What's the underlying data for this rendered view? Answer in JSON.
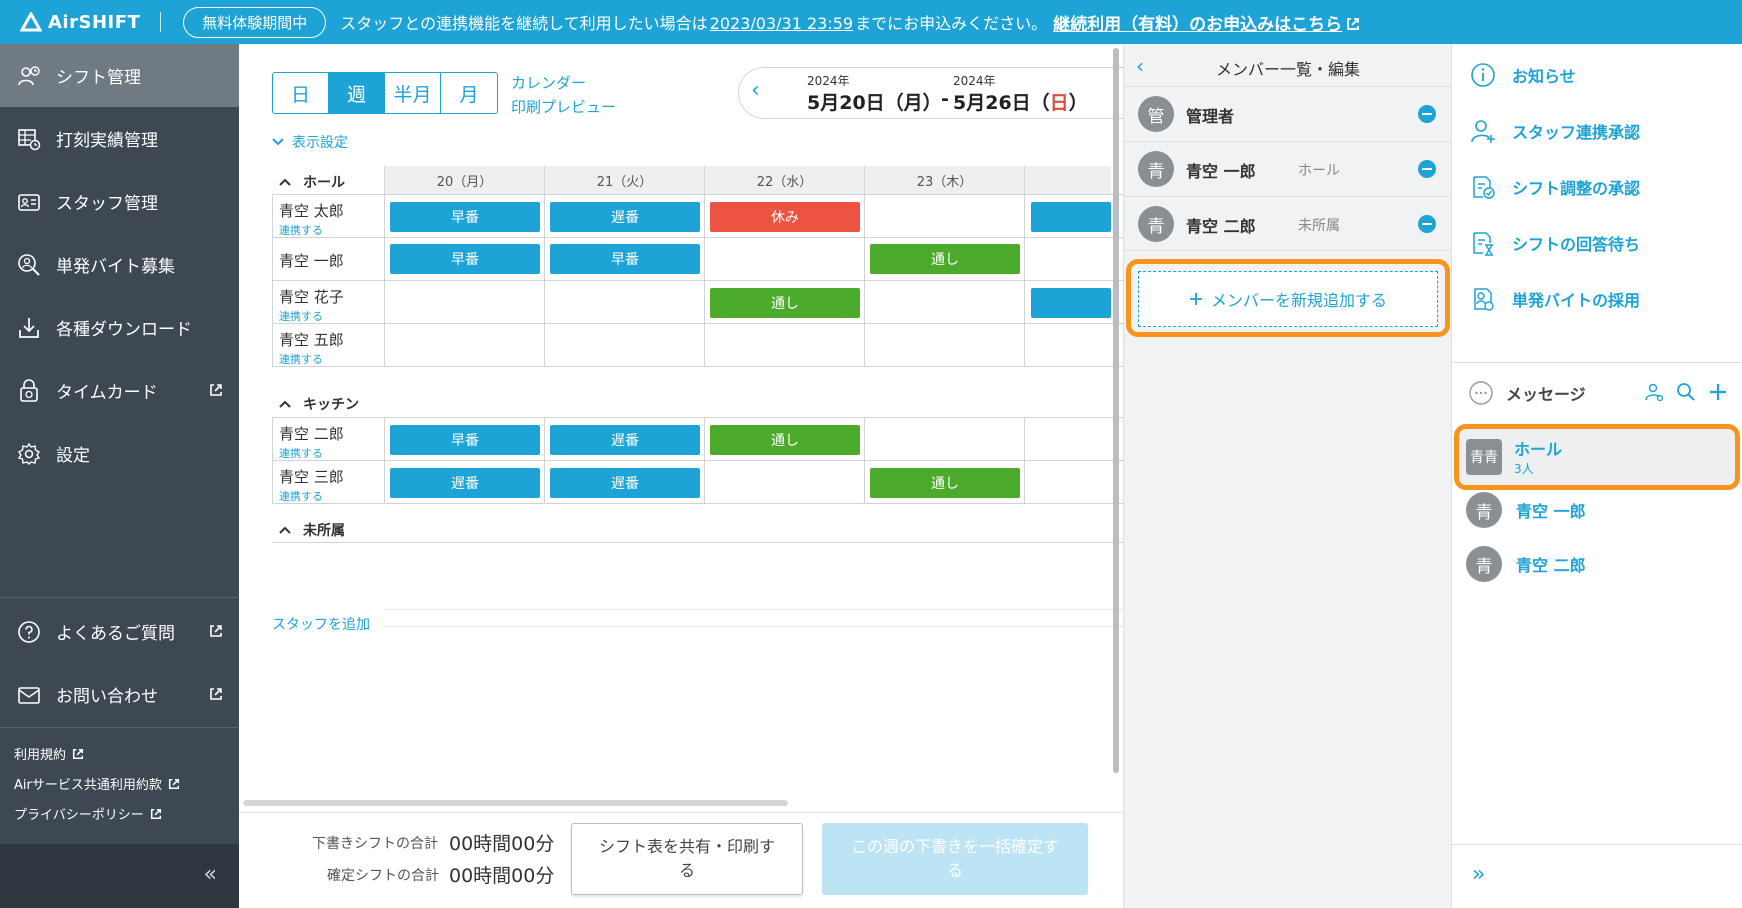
{
  "banner": {
    "logo": "AirSHIFT",
    "trial_badge": "無料体験期間中",
    "text_before": "スタッフとの連携機能を継続して利用したい場合は",
    "deadline": "2023/03/31 23:59",
    "text_after": "までにお申込みください。",
    "cta": "継続利用（有料）のお申込みはこちら"
  },
  "sidebar": {
    "items": [
      {
        "label": "シフト管理"
      },
      {
        "label": "打刻実績管理"
      },
      {
        "label": "スタッフ管理"
      },
      {
        "label": "単発バイト募集"
      },
      {
        "label": "各種ダウンロード"
      },
      {
        "label": "タイムカード"
      },
      {
        "label": "設定"
      }
    ],
    "faq": "よくあるご質問",
    "contact": "お問い合わせ",
    "terms": "利用規約",
    "air_terms": "Airサービス共通利用約款",
    "privacy": "プライバシーポリシー",
    "collapse": "«"
  },
  "toolbar": {
    "views": [
      "日",
      "週",
      "半月",
      "月"
    ],
    "selected_view": "週",
    "calendar": "カレンダー",
    "print_preview": "印刷プレビュー",
    "display_settings": "表示設定"
  },
  "date_range": {
    "start_year": "2024年",
    "start": "5月20日（月）",
    "separator": "-",
    "end_year": "2024年",
    "end_prefix": "5月26日（",
    "end_day": "日",
    "end_suffix": "）"
  },
  "grid": {
    "days": [
      "20（月）",
      "21（火）",
      "22（水）",
      "23（木）"
    ],
    "groups": [
      "ホール",
      "キッチン",
      "未所属"
    ],
    "link_label": "連携する",
    "rows": [
      {
        "name": "青空 太郎",
        "link": true,
        "shifts": [
          "早番",
          "遅番",
          "休み",
          ""
        ]
      },
      {
        "name": "青空 一郎",
        "link": false,
        "shifts": [
          "早番",
          "早番",
          "",
          "通し"
        ]
      },
      {
        "name": "青空 花子",
        "link": true,
        "shifts": [
          "",
          "",
          "通し",
          ""
        ]
      },
      {
        "name": "青空 五郎",
        "link": true,
        "shifts": [
          "",
          "",
          "",
          ""
        ]
      },
      {
        "name": "青空 二郎",
        "link": true,
        "shifts": [
          "早番",
          "遅番",
          "通し",
          ""
        ]
      },
      {
        "name": "青空 三郎",
        "link": true,
        "shifts": [
          "遅番",
          "遅番",
          "",
          "通し"
        ]
      }
    ],
    "add_staff": "スタッフを追加"
  },
  "bottom": {
    "draft_label": "下書きシフトの合計",
    "draft_value": "00時間00分",
    "confirmed_label": "確定シフトの合計",
    "confirmed_value": "00時間00分",
    "share_line1": "シフト表を共有・印刷す",
    "share_line2": "る",
    "confirm_line1": "この週の下書きを一括確定す",
    "confirm_line2": "る"
  },
  "member_panel": {
    "title": "メンバー一覧・編集",
    "members": [
      {
        "avatar": "管",
        "name": "管理者",
        "tag": ""
      },
      {
        "avatar": "青",
        "name": "青空 一郎",
        "tag": "ホール"
      },
      {
        "avatar": "青",
        "name": "青空 二郎",
        "tag": "未所属"
      }
    ],
    "add_member": "メンバーを新規追加する"
  },
  "right_panel": {
    "items": [
      {
        "label": "お知らせ"
      },
      {
        "label": "スタッフ連携承認"
      },
      {
        "label": "シフト調整の承認"
      },
      {
        "label": "シフトの回答待ち"
      },
      {
        "label": "単発バイトの採用"
      }
    ],
    "message_title": "メッセージ",
    "threads": [
      {
        "avatar": "青青",
        "name": "ホール",
        "sub": "3人"
      },
      {
        "avatar": "青",
        "name": "青空 一郎",
        "sub": ""
      },
      {
        "avatar": "青",
        "name": "青空 二郎",
        "sub": ""
      }
    ],
    "expand": "»"
  },
  "colors": {
    "accent": "#1ea3d6",
    "sidebar": "#3d4852",
    "early_late": "#1ea3d6",
    "full_day": "#4cab2a",
    "off": "#ec5343",
    "highlight": "#f7941d"
  }
}
